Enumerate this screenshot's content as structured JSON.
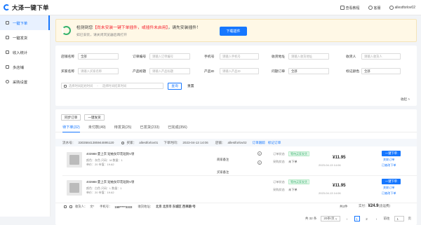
{
  "app": {
    "title": "大泽一键下单"
  },
  "topbar": {
    "help": "查看教程",
    "orders": "客服",
    "user": "allestforlov02"
  },
  "sidebar": {
    "items": [
      "一键下单",
      "一键发货",
      "收入统计",
      "多店铺",
      "采购设置"
    ]
  },
  "notice": {
    "prefix": "检测到您",
    "highlight": "【尚未安装一键下单插件，或插件未启用】",
    "suffix": "，请先安装插件！",
    "sub": "如已安装，请关闭浏览器后再打开",
    "button": "下载插件"
  },
  "filters": {
    "row1": [
      {
        "label": "店铺名称",
        "value": "全部",
        "type": "select"
      },
      {
        "label": "订单编号",
        "value": "请输入订单编号",
        "type": "input"
      },
      {
        "label": "手机号",
        "value": "请输入手机号",
        "type": "input"
      },
      {
        "label": "收货地址",
        "value": "请输入收货地址",
        "type": "input"
      },
      {
        "label": "收货人",
        "value": "请输入收货人",
        "type": "input"
      }
    ],
    "row2": [
      {
        "label": "买家名称",
        "value": "请输入买家名称",
        "type": "input"
      },
      {
        "label": "产品标题",
        "value": "请输入产品标题",
        "type": "input"
      },
      {
        "label": "产品ID",
        "value": "请输入产品ID",
        "type": "input"
      },
      {
        "label": "问题订单",
        "value": "全部",
        "type": "select"
      },
      {
        "label": "标记颜色",
        "value": "全部",
        "type": "select"
      }
    ],
    "date_start": "选择时间起始时间",
    "date_end": "选择时间结束时间",
    "search": "查询",
    "reset": "重置",
    "collapse": "收起"
  },
  "list": {
    "buttons": [
      "同步订单",
      "一键发货"
    ],
    "tabs": [
      "待下单(32)",
      "未付款(49)",
      "待发货(25)",
      "已发货(233)",
      "已完成(356)"
    ],
    "order_header": {
      "order_no_label": "流水号：",
      "order_no": "33035841385944895120",
      "buyer_label": "买家：",
      "buyer": "allestforlov01",
      "time_label": "下单时间：",
      "time": "2023-04-13 14:06",
      "shop_label": "店铺：",
      "shop": "allestforlov02",
      "links": [
        "订单跟踪",
        "标记订单"
      ]
    },
    "rows": [
      {
        "name": "403988 夏上衣 短袖女印花短款V领",
        "attr1": "颜色：灰色  尺码：M  数量：1",
        "attr2": "单价：20  市值：19.62",
        "tag": "等待买家发货",
        "status1_label": "订单状态",
        "status2_label": "采购状态",
        "status2": "未下单",
        "price": "¥11.95",
        "pay_date": "2023-04-13 14:06",
        "op": "一键下单",
        "link1": "关联订单",
        "link2": "已被改下单"
      },
      {
        "name": "403988 夏上衣 短袖女印花短款V领",
        "attr1": "颜色：白色  尺码：L  数量：1",
        "attr2": "单价：20  市值：19.62",
        "tag": "等待买家发货",
        "status1_label": "订单状态",
        "status2_label": "采购状态",
        "status2": "未下单",
        "price": "¥11.95",
        "pay_date": "2023-04-13 14:06",
        "op": "一键下单",
        "link1": "关联订单",
        "link2": "已被改下单"
      }
    ],
    "notes": [
      "商家备注",
      "买家备注"
    ],
    "footer": {
      "receiver_label": "收货人：",
      "receiver": "文*",
      "phone_label": "手机号：",
      "phone": "158*****3333",
      "addr_label": "收货地址：",
      "addr": "北京 北京市 东城区 西单路*号",
      "total_qty": "共2件",
      "total_label": "实付：",
      "total": "¥24.9",
      "total_extra": "(含运费)"
    },
    "pager": {
      "total": "共 32 条",
      "size": "20条/页",
      "pages": [
        "1",
        "2"
      ],
      "current": "1",
      "goto": "前往",
      "goto_val": "1",
      "unit": "页"
    }
  },
  "colors": {
    "accent": "#1677ff",
    "warn": "#f5222d",
    "ok": "#36b36d"
  }
}
